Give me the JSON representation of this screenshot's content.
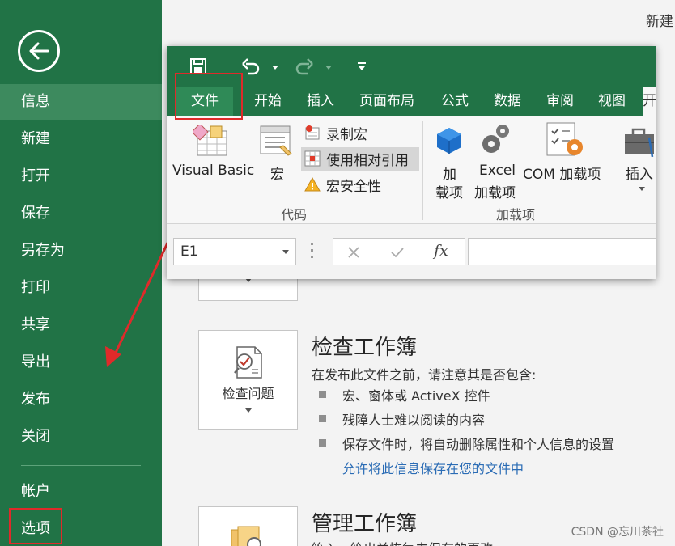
{
  "sidebar": {
    "items": [
      {
        "label": "信息"
      },
      {
        "label": "新建"
      },
      {
        "label": "打开"
      },
      {
        "label": "保存"
      },
      {
        "label": "另存为"
      },
      {
        "label": "打印"
      },
      {
        "label": "共享"
      },
      {
        "label": "导出"
      },
      {
        "label": "发布"
      },
      {
        "label": "关闭"
      },
      {
        "label": "帐户"
      },
      {
        "label": "选项"
      }
    ]
  },
  "main": {
    "top_right_label": "新建",
    "inspect": {
      "button_label": "检查问题",
      "title": "检查工作簿",
      "description": "在发布此文件之前，请注意其是否包含:",
      "bullets": [
        "宏、窗体或 ActiveX 控件",
        "残障人士难以阅读的内容",
        "保存文件时，将自动删除属性和个人信息的设置"
      ],
      "link": "允许将此信息保存在您的文件中"
    },
    "manage": {
      "title": "管理工作簿",
      "description": "签入、签出并恢复未保存的更改。"
    }
  },
  "excel_window": {
    "tabs": [
      "文件",
      "开始",
      "插入",
      "页面布局",
      "公式",
      "数据",
      "审阅",
      "视图",
      "开"
    ],
    "ribbon": {
      "visual_basic": "Visual Basic",
      "macros": "宏",
      "record_macro": "录制宏",
      "relative_ref": "使用相对引用",
      "macro_security": "宏安全性",
      "code_group": "代码",
      "addins_line1": "加",
      "addins_line2": "载项",
      "excel_addins_line1": "Excel",
      "excel_addins_line2": "加载项",
      "com_addins": "COM 加载项",
      "addins_group": "加载项",
      "insert": "插入"
    },
    "formula_bar": {
      "name_box": "E1",
      "fx": "fx"
    }
  },
  "watermark": "CSDN @忘川茶社",
  "colors": {
    "excel_green": "#217346",
    "highlight_red": "#e02a2a",
    "link_blue": "#2b6cb5"
  }
}
